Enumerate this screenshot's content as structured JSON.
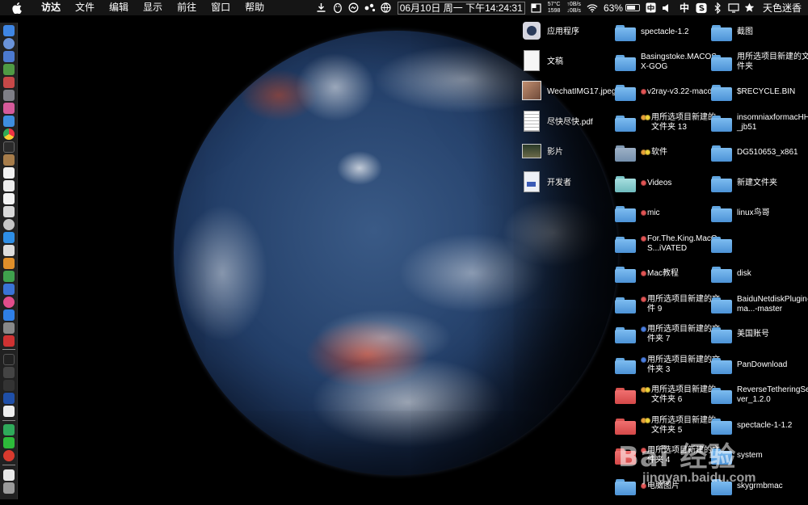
{
  "menubar": {
    "app_name": "访达",
    "menus": [
      "文件",
      "编辑",
      "显示",
      "前往",
      "窗口",
      "帮助"
    ],
    "temperature": "57°C",
    "fan": "1598",
    "net_up": "↑0B/s",
    "net_down": "↓0B/s",
    "clock": "06月10日 周一 下午14:24:31",
    "battery": "63%",
    "ime": "中",
    "user": "天色迷香"
  },
  "desktop": {
    "items": [
      {
        "label": "应用程序",
        "icon": "applications-icon",
        "tags": []
      },
      {
        "label": "文稿",
        "icon": "document-icon",
        "tags": []
      },
      {
        "label": "WechatIMG17.jpeg",
        "icon": "image-file-icon",
        "tags": []
      },
      {
        "label": "尽快尽快.pdf",
        "icon": "pdf-icon",
        "tags": []
      },
      {
        "label": "影片",
        "icon": "movies-icon",
        "tags": []
      },
      {
        "label": "开发者",
        "icon": "developer-icon",
        "tags": []
      },
      {
        "label": "spectacle-1.2",
        "icon": "folder-icon",
        "color": "blue",
        "tags": []
      },
      {
        "label": "Basingstoke.MACOSX-GOG",
        "icon": "folder-icon",
        "color": "blue",
        "tags": []
      },
      {
        "label": "v2ray-v3.22-macos",
        "icon": "folder-icon",
        "color": "blue",
        "tags": [
          "#e25555"
        ]
      },
      {
        "label": "用所选项目新建的文件夹 13",
        "icon": "folder-icon",
        "color": "blue",
        "tags": [
          "#e8a03a",
          "#f0d23a"
        ]
      },
      {
        "label": "软件",
        "icon": "folder-icon",
        "color": "gray",
        "tags": [
          "#e8a03a",
          "#f0d23a"
        ]
      },
      {
        "label": "Videos",
        "icon": "folder-icon",
        "color": "teal",
        "tags": [
          "#e25555"
        ]
      },
      {
        "label": "mic",
        "icon": "folder-icon",
        "color": "blue",
        "tags": [
          "#e25555"
        ]
      },
      {
        "label": "For.The.King.MacOS...iVATED",
        "icon": "folder-icon",
        "color": "blue",
        "tags": [
          "#e25555"
        ]
      },
      {
        "label": "Mac教程",
        "icon": "folder-icon",
        "color": "blue",
        "tags": [
          "#e25555"
        ]
      },
      {
        "label": "用所选项目新建的文件 9",
        "icon": "folder-icon",
        "color": "blue",
        "tags": [
          "#e25555"
        ]
      },
      {
        "label": "用所选项目新建的文件夹 7",
        "icon": "folder-icon",
        "color": "blue",
        "tags": [
          "#4a7ee0"
        ]
      },
      {
        "label": "用所选项目新建的文件夹 3",
        "icon": "folder-icon",
        "color": "blue",
        "tags": [
          "#4a7ee0"
        ]
      },
      {
        "label": "用所选项目新建的文件夹 6",
        "icon": "folder-icon",
        "color": "red",
        "tags": [
          "#e8a03a",
          "#f0d23a"
        ]
      },
      {
        "label": "用所选项目新建的文件夹 5",
        "icon": "folder-icon",
        "color": "red",
        "tags": [
          "#e8a03a",
          "#f0d23a"
        ]
      },
      {
        "label": "用所选项目新建的文件夹 4",
        "icon": "folder-icon",
        "color": "red",
        "tags": [
          "#e25555"
        ]
      },
      {
        "label": "电脑图片",
        "icon": "folder-icon",
        "color": "blue",
        "tags": [
          "#e25555"
        ]
      },
      {
        "label": "截图",
        "icon": "folder-icon",
        "color": "blue",
        "tags": []
      },
      {
        "label": "用所选项目新建的文件夹",
        "icon": "folder-icon",
        "color": "blue",
        "tags": []
      },
      {
        "label": "$RECYCLE.BIN",
        "icon": "folder-icon",
        "color": "blue",
        "tags": []
      },
      {
        "label": "insomniaxformacHHB_jb51",
        "icon": "folder-icon",
        "color": "blue",
        "tags": []
      },
      {
        "label": "DG510653_x861",
        "icon": "folder-icon",
        "color": "blue",
        "tags": []
      },
      {
        "label": "新建文件夹",
        "icon": "folder-icon",
        "color": "blue",
        "tags": []
      },
      {
        "label": "linux鸟哥",
        "icon": "folder-icon",
        "color": "blue",
        "tags": []
      },
      {
        "label": "",
        "icon": "folder-icon",
        "color": "blue",
        "tags": []
      },
      {
        "label": "disk",
        "icon": "folder-icon",
        "color": "blue",
        "tags": []
      },
      {
        "label": "BaiduNetdiskPlugin-ma...-master",
        "icon": "folder-icon",
        "color": "blue",
        "tags": []
      },
      {
        "label": "美国账号",
        "icon": "folder-icon",
        "color": "blue",
        "tags": []
      },
      {
        "label": "PanDownload",
        "icon": "folder-icon",
        "color": "blue",
        "tags": []
      },
      {
        "label": "ReverseTetheringServer_1.2.0",
        "icon": "folder-icon",
        "color": "blue",
        "tags": []
      },
      {
        "label": "spectacle-1-1.2",
        "icon": "folder-icon",
        "color": "blue",
        "tags": []
      },
      {
        "label": "system",
        "icon": "folder-icon",
        "color": "blue",
        "tags": []
      },
      {
        "label": "skygrmbmac",
        "icon": "folder-icon",
        "color": "blue",
        "tags": []
      }
    ]
  },
  "watermark": {
    "brand": "Bai 经验",
    "url": "jingyan.baidu.com"
  }
}
